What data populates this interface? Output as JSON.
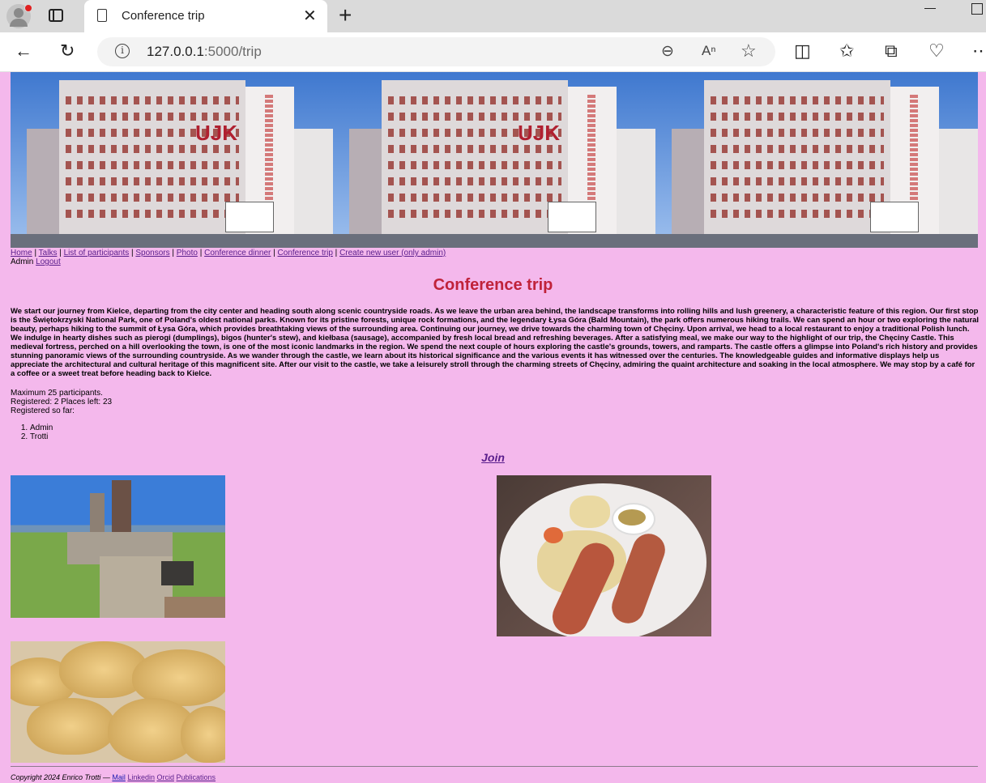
{
  "browser": {
    "tab_title": "Conference trip",
    "url_host": "127.0.0.1",
    "url_rest": ":5000/trip"
  },
  "nav": {
    "items": [
      "Home",
      "Talks",
      "List of participants",
      "Sponsors",
      "Photo",
      "Conference dinner",
      "Conference trip",
      "Create new user (only admin)"
    ],
    "user": "Admin",
    "logout": "Logout"
  },
  "main": {
    "title": "Conference trip",
    "description": "We start our journey from Kielce, departing from the city center and heading south along scenic countryside roads. As we leave the urban area behind, the landscape transforms into rolling hills and lush greenery, a characteristic feature of this region. Our first stop is the Świętokrzyski National Park, one of Poland's oldest national parks. Known for its pristine forests, unique rock formations, and the legendary Łysa Góra (Bald Mountain), the park offers numerous hiking trails. We can spend an hour or two exploring the natural beauty, perhaps hiking to the summit of Łysa Góra, which provides breathtaking views of the surrounding area. Continuing our journey, we drive towards the charming town of Chęciny. Upon arrival, we head to a local restaurant to enjoy a traditional Polish lunch. We indulge in hearty dishes such as pierogi (dumplings), bigos (hunter's stew), and kiełbasa (sausage), accompanied by fresh local bread and refreshing beverages. After a satisfying meal, we make our way to the highlight of our trip, the Chęciny Castle. This medieval fortress, perched on a hill overlooking the town, is one of the most iconic landmarks in the region. We spend the next couple of hours exploring the castle's grounds, towers, and ramparts. The castle offers a glimpse into Poland's rich history and provides stunning panoramic views of the surrounding countryside. As we wander through the castle, we learn about its historical significance and the various events it has witnessed over the centuries. The knowledgeable guides and informative displays help us appreciate the architectural and cultural heritage of this magnificent site. After our visit to the castle, we take a leisurely stroll through the charming streets of Chęciny, admiring the quaint architecture and soaking in the local atmosphere. We may stop by a café for a coffee or a sweet treat before heading back to Kielce.",
    "max_line": "Maximum 25 participants.",
    "registered_line": "Registered: 2 Places left: 23",
    "registered_so_far": "Registered so far:",
    "participants": [
      "Admin",
      "Trotti"
    ],
    "join_label": "Join"
  },
  "footer": {
    "copyright": "Copyright 2024 Enrico Trotti —",
    "links": [
      "Mail",
      "Linkedin",
      "Orcid",
      "Publications"
    ]
  },
  "colors": {
    "page_background": "#f4b8ec",
    "title_red": "#c0223a",
    "link_visited": "#5a1e8c"
  }
}
